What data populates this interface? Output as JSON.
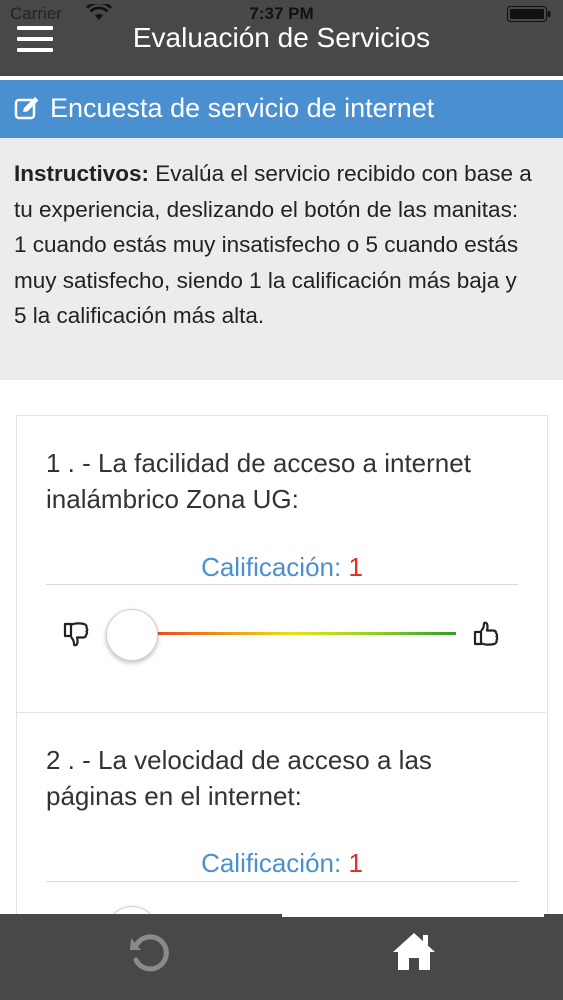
{
  "status_bar": {
    "carrier": "Carrier",
    "time": "7:37 PM"
  },
  "header": {
    "title": "Evaluación de Servicios",
    "menu_icon": "hamburger-menu-icon"
  },
  "section": {
    "title": "Encuesta de servicio de internet",
    "icon": "edit-icon",
    "color": "#4a90d0"
  },
  "instructions": {
    "label": "Instructivos:",
    "text": " Evalúa el servicio recibido con base a tu experiencia, deslizando el botón de las manitas: 1 cuando estás muy insatisfecho o 5 cuando estás muy satisfecho, siendo 1 la calificación más baja y 5 la calificación más alta."
  },
  "questions": [
    {
      "text": "1 . - La facilidad de acceso a internet inalámbrico Zona UG:",
      "rating_label": "Calificación:",
      "rating_value": "1"
    },
    {
      "text": "2 . - La velocidad de acceso a las páginas en el internet:",
      "rating_label": "Calificación:",
      "rating_value": "1"
    }
  ],
  "slider": {
    "min": 1,
    "max": 5,
    "value": 1,
    "left_icon": "thumbs-down-icon",
    "right_icon": "thumbs-up-icon"
  },
  "bottom_bar": {
    "left_icon": "reload-icon",
    "right_icon": "home-icon"
  },
  "colors": {
    "header": "#484848",
    "rating_label": "#4a90d0",
    "rating_value": "#e0302a"
  }
}
